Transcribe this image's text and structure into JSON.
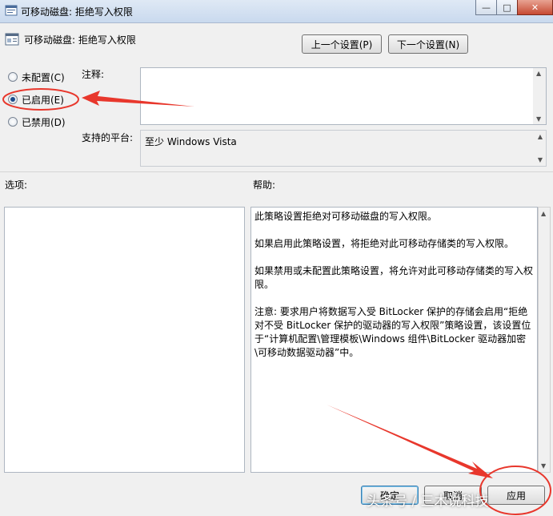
{
  "window": {
    "title": "可移动磁盘: 拒绝写入权限"
  },
  "header": {
    "title": "可移动磁盘: 拒绝写入权限",
    "prev_button": "上一个设置(P)",
    "next_button": "下一个设置(N)"
  },
  "state_options": [
    {
      "label": "未配置(C)",
      "selected": false
    },
    {
      "label": "已启用(E)",
      "selected": true
    },
    {
      "label": "已禁用(D)",
      "selected": false
    }
  ],
  "comment": {
    "label": "注释:",
    "value": ""
  },
  "platform": {
    "label": "支持的平台:",
    "value": "至少 Windows Vista"
  },
  "options": {
    "label": "选项:"
  },
  "help": {
    "label": "帮助:",
    "text": "此策略设置拒绝对可移动磁盘的写入权限。\n\n如果启用此策略设置，将拒绝对此可移动存储类的写入权限。\n\n如果禁用或未配置此策略设置，将允许对此可移动存储类的写入权限。\n\n注意: 要求用户将数据写入受 BitLocker 保护的存储会启用“拒绝对不受 BitLocker 保护的驱动器的写入权限”策略设置，该设置位于“计算机配置\\管理模板\\Windows 组件\\BitLocker 驱动器加密\\可移动数据驱动器”中。"
  },
  "footer": {
    "ok_button": "确定",
    "cancel_button": "取消",
    "apply_button": "应用"
  },
  "watermark": "头条号 / 三木说科技",
  "colors": {
    "annotation_red": "#e8372c",
    "selected_radio": "#1e4d8c"
  }
}
